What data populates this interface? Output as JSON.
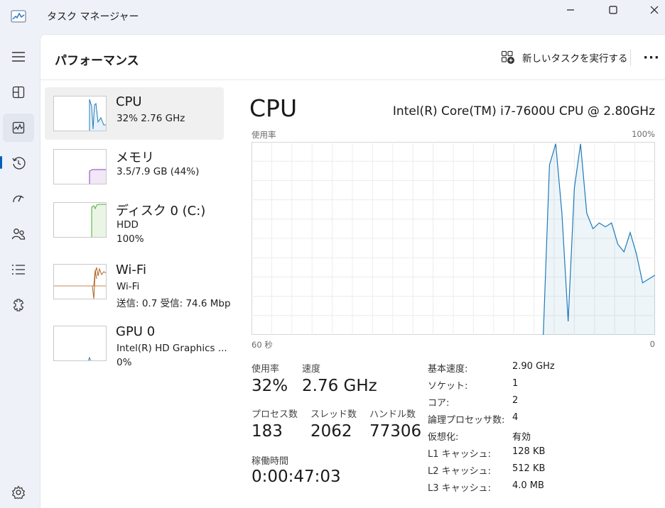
{
  "window": {
    "title": "タスク マネージャー",
    "accent": "#005fb8"
  },
  "header": {
    "page_title": "パフォーマンス",
    "new_task_label": "新しいタスクを実行する",
    "more_label": "···"
  },
  "nav": {
    "items": [
      {
        "name": "hamburger-menu-icon"
      },
      {
        "name": "processes-icon"
      },
      {
        "name": "performance-icon",
        "active": true
      },
      {
        "name": "app-history-icon"
      },
      {
        "name": "startup-apps-icon"
      },
      {
        "name": "users-icon"
      },
      {
        "name": "details-icon"
      },
      {
        "name": "services-icon"
      },
      {
        "name": "settings-icon"
      }
    ]
  },
  "resources": [
    {
      "name": "CPU",
      "line1": "32%  2.76 GHz",
      "line2": "",
      "color": "#1f7ab8"
    },
    {
      "name": "メモリ",
      "line1": "3.5/7.9 GB (44%)",
      "line2": "",
      "color": "#8e3cb6"
    },
    {
      "name": "ディスク 0 (C:)",
      "line1": "HDD",
      "line2": "100%",
      "color": "#4cab32"
    },
    {
      "name": "Wi-Fi",
      "line1": "Wi-Fi",
      "line2": "送信: 0.7  受信: 74.6 Mbp",
      "color": "#b0621d"
    },
    {
      "name": "GPU 0",
      "line1": "Intel(R) HD Graphics ...",
      "line2": "0%",
      "color": "#1f7ab8"
    }
  ],
  "detail": {
    "title": "CPU",
    "model": "Intel(R) Core(TM) i7-7600U CPU @ 2.80GHz",
    "y_label": "使用率",
    "y_max_label": "100%",
    "x_left_label": "60 秒",
    "x_right_label": "0",
    "graph_color": "#1f7ab8",
    "stats": {
      "usage_label": "使用率",
      "usage_value": "32%",
      "speed_label": "速度",
      "speed_value": "2.76 GHz",
      "processes_label": "プロセス数",
      "processes_value": "183",
      "threads_label": "スレッド数",
      "threads_value": "2062",
      "handles_label": "ハンドル数",
      "handles_value": "77306",
      "uptime_label": "稼働時間",
      "uptime_value": "0:00:47:03"
    },
    "specs": [
      {
        "label": "基本速度:",
        "value": "2.90 GHz"
      },
      {
        "label": "ソケット:",
        "value": "1"
      },
      {
        "label": "コア:",
        "value": "2"
      },
      {
        "label": "論理プロセッサ数:",
        "value": "4"
      },
      {
        "label": "仮想化:",
        "value": "有効"
      },
      {
        "label": "L1 キャッシュ:",
        "value": "128 KB"
      },
      {
        "label": "L2 キャッシュ:",
        "value": "512 KB"
      },
      {
        "label": "L3 キャッシュ:",
        "value": "4.0 MB"
      }
    ]
  },
  "chart_data": {
    "type": "area",
    "title": "CPU",
    "ylabel": "使用率",
    "x_range_seconds": [
      60,
      0
    ],
    "ylim": [
      0,
      100
    ],
    "x": [
      60,
      59,
      58,
      57,
      56,
      55,
      54,
      53,
      52,
      51,
      50,
      49,
      48,
      47,
      46,
      45,
      44,
      43,
      42,
      41,
      40,
      39,
      38,
      37,
      36,
      35,
      34,
      33,
      32,
      31,
      30,
      29,
      28,
      27,
      26,
      25,
      24,
      23,
      22,
      21,
      20,
      19,
      18,
      17,
      16,
      15,
      14,
      13,
      12,
      11,
      10,
      9,
      8,
      7,
      6,
      5,
      4,
      3,
      2,
      1,
      0
    ],
    "series": [
      {
        "values": [
          0,
          0,
          0,
          0,
          0,
          0,
          0,
          0,
          0,
          0,
          0,
          0,
          0,
          0,
          0,
          0,
          0,
          0,
          0,
          0,
          0,
          0,
          0,
          0,
          0,
          0,
          0,
          0,
          0,
          0,
          0,
          0,
          0,
          0,
          0,
          0,
          0,
          0,
          0,
          0,
          0,
          0,
          0,
          0,
          0,
          0,
          0,
          0,
          88,
          99,
          63,
          7,
          76,
          99,
          63,
          55,
          58,
          56,
          58,
          47,
          43,
          53,
          42,
          27,
          29,
          31
        ]
      }
    ]
  }
}
